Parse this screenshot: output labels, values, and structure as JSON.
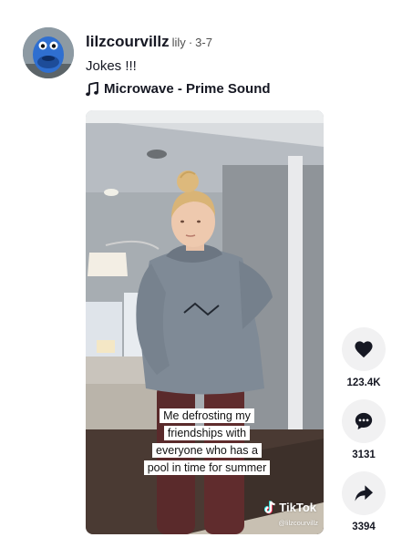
{
  "post": {
    "username": "lilzcourvillz",
    "nickname": "lily",
    "separator": "·",
    "date": "3-7",
    "caption": "Jokes !!!",
    "music": {
      "icon": "music-note-icon",
      "title": "Microwave - Prime Sound"
    }
  },
  "video": {
    "overlay_lines": [
      "Me defrosting my",
      "friendships with",
      "everyone who has a",
      "pool in time for summer"
    ],
    "watermark_brand": "TikTok",
    "watermark_handle": "@lilzcourvillz"
  },
  "actions": {
    "like": {
      "icon": "heart-icon",
      "count": "123.4K"
    },
    "comment": {
      "icon": "comment-icon",
      "count": "3131"
    },
    "share": {
      "icon": "share-icon",
      "count": "3394"
    }
  },
  "colors": {
    "text_primary": "#161823",
    "text_secondary": "#505050",
    "action_bg": "#f1f1f2"
  }
}
